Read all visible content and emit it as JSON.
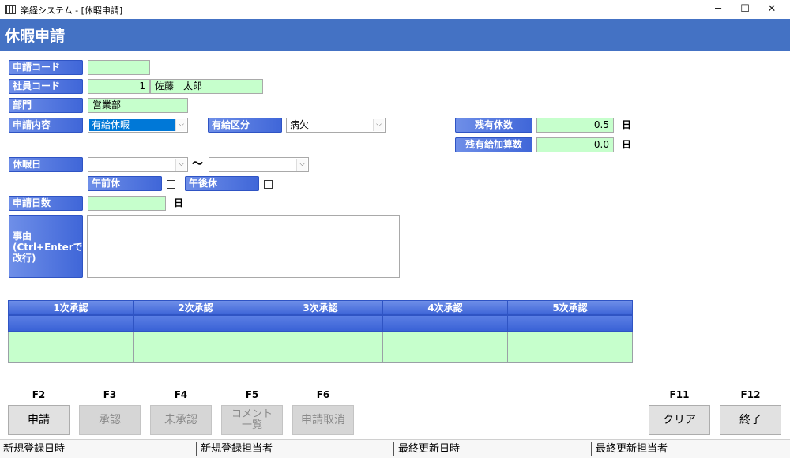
{
  "window": {
    "title": "楽経システム - [休暇申請]",
    "minimize": "─",
    "maximize": "☐",
    "close": "✕"
  },
  "header": {
    "title": "休暇申請"
  },
  "form": {
    "application_code": {
      "label": "申請コード",
      "value": ""
    },
    "employee_code": {
      "label": "社員コード",
      "value": "1",
      "name": "佐藤　太郎"
    },
    "department": {
      "label": "部門",
      "value": "営業部"
    },
    "application_content": {
      "label": "申請内容",
      "selected": "有給休暇"
    },
    "paid_category": {
      "label": "有給区分",
      "selected": "病欠"
    },
    "remaining_days": {
      "label": "残有休数",
      "value": "0.5",
      "unit": "日"
    },
    "remaining_added": {
      "label": "残有給加算数",
      "value": "0.0",
      "unit": "日"
    },
    "leave_date": {
      "label": "休暇日",
      "from": "",
      "separator": "〜",
      "to": ""
    },
    "morning_off": {
      "label": "午前休",
      "checked": false
    },
    "afternoon_off": {
      "label": "午後休",
      "checked": false
    },
    "application_days": {
      "label": "申請日数",
      "value": "",
      "unit": "日"
    },
    "reason": {
      "label": "事由\n(Ctrl+Enterで\n改行)",
      "value": ""
    }
  },
  "approvals": {
    "columns": [
      "1次承認",
      "2次承認",
      "3次承認",
      "4次承認",
      "5次承認"
    ]
  },
  "function_keys": [
    {
      "key": "F2",
      "label": "申請",
      "enabled": true
    },
    {
      "key": "F3",
      "label": "承認",
      "enabled": false
    },
    {
      "key": "F4",
      "label": "未承認",
      "enabled": false
    },
    {
      "key": "F5",
      "label": "コメント\n一覧",
      "enabled": false
    },
    {
      "key": "F6",
      "label": "申請取消",
      "enabled": false
    },
    {
      "key": "F11",
      "label": "クリア",
      "enabled": true
    },
    {
      "key": "F12",
      "label": "終了",
      "enabled": true
    }
  ],
  "status_bar": [
    "新規登録日時",
    "新規登録担当者",
    "最終更新日時",
    "最終更新担当者"
  ],
  "colors": {
    "banner": "#4472c4",
    "label": "#3f66d8",
    "field": "#c6ffcc",
    "selection": "#0078d7"
  },
  "icons": {
    "dropdown": "⌵",
    "check": "☐"
  }
}
